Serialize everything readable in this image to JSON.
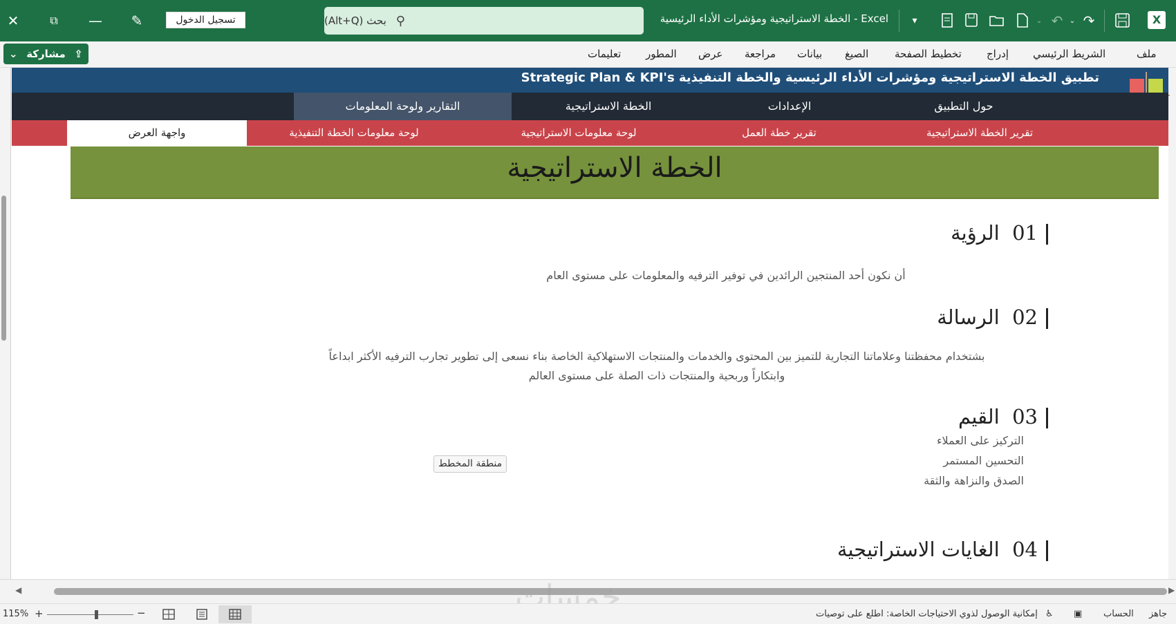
{
  "titlebar": {
    "close": "✕",
    "restore": "⧉",
    "minimize": "—",
    "pen": "✎",
    "signin_label": "تسجيل الدخول",
    "search_placeholder": "بحث (Alt+Q)",
    "doc_title": "الخطة الاستراتيجية ومؤشرات الأداء الرئيسية  -  Excel",
    "qat_more": "▾",
    "excel_logo": "X"
  },
  "menubar": {
    "share_label": "مشاركة",
    "share_chevron": "⌄",
    "items": [
      "ملف",
      "الشريط الرئيسي",
      "إدراج",
      "تخطيط الصفحة",
      "الصيغ",
      "بيانات",
      "مراجعة",
      "عرض",
      "المطور",
      "تعليمات"
    ]
  },
  "app": {
    "title": "تطبيق الخطة الاستراتيجية ومؤشرات الأداء الرئيسية والخطة التنفيذية Strategic Plan & KPI's",
    "nav": [
      "حول التطبيق",
      "الإعدادات",
      "الخطة الاستراتيجية",
      "التقارير ولوحة المعلومات"
    ],
    "subnav": [
      "تقرير الخطة الاستراتيجية",
      "تقرير خطة العمل",
      "لوحة معلومات الاستراتيجية",
      "لوحة معلومات الخطة التنفيذية",
      "واجهة العرض"
    ],
    "banner": "الخطة الاستراتيجية"
  },
  "sections": {
    "vision": {
      "num": "01",
      "title": "الرؤية",
      "text": "أن نكون أحد المنتجين الرائدين في توفير الترفيه والمعلومات على مستوى العام"
    },
    "mission": {
      "num": "02",
      "title": "الرسالة",
      "line1": "بشتخدام محفظتنا وعلاماتنا التجارية للتميز بين المحتوى والخدمات والمنتجات الاستهلاكية الخاصة بناء نسعى إلى تطوير تجارب الترفيه الأكثر ابداعاً",
      "line2": "وابتكاراً وربحية والمنتجات ذات الصلة على مستوى العالم"
    },
    "values": {
      "num": "03",
      "title": "القيم",
      "items": [
        "التركيز على العملاء",
        "التحسين المستمر",
        "الصدق والنزاهة والثقة"
      ]
    },
    "goals": {
      "num": "04",
      "title": "الغايات الاستراتيجية"
    }
  },
  "chart_area_tip": "منطقة المخطط",
  "statusbar": {
    "ready": "جاهز",
    "account": "الحساب",
    "accessibility": "إمكانية الوصول لذوي الاحتياجات الخاصة: اطلع على توصيات",
    "zoom": "115%",
    "zoom_level": 0.57
  },
  "watermark": "خمسات",
  "colors": {
    "excel_green": "#1e7145",
    "header_blue": "#1f4e79",
    "nav_dark": "#222a35",
    "nav_active": "#44546a",
    "subnav_red": "#c9444a",
    "banner_green": "#76923c"
  }
}
